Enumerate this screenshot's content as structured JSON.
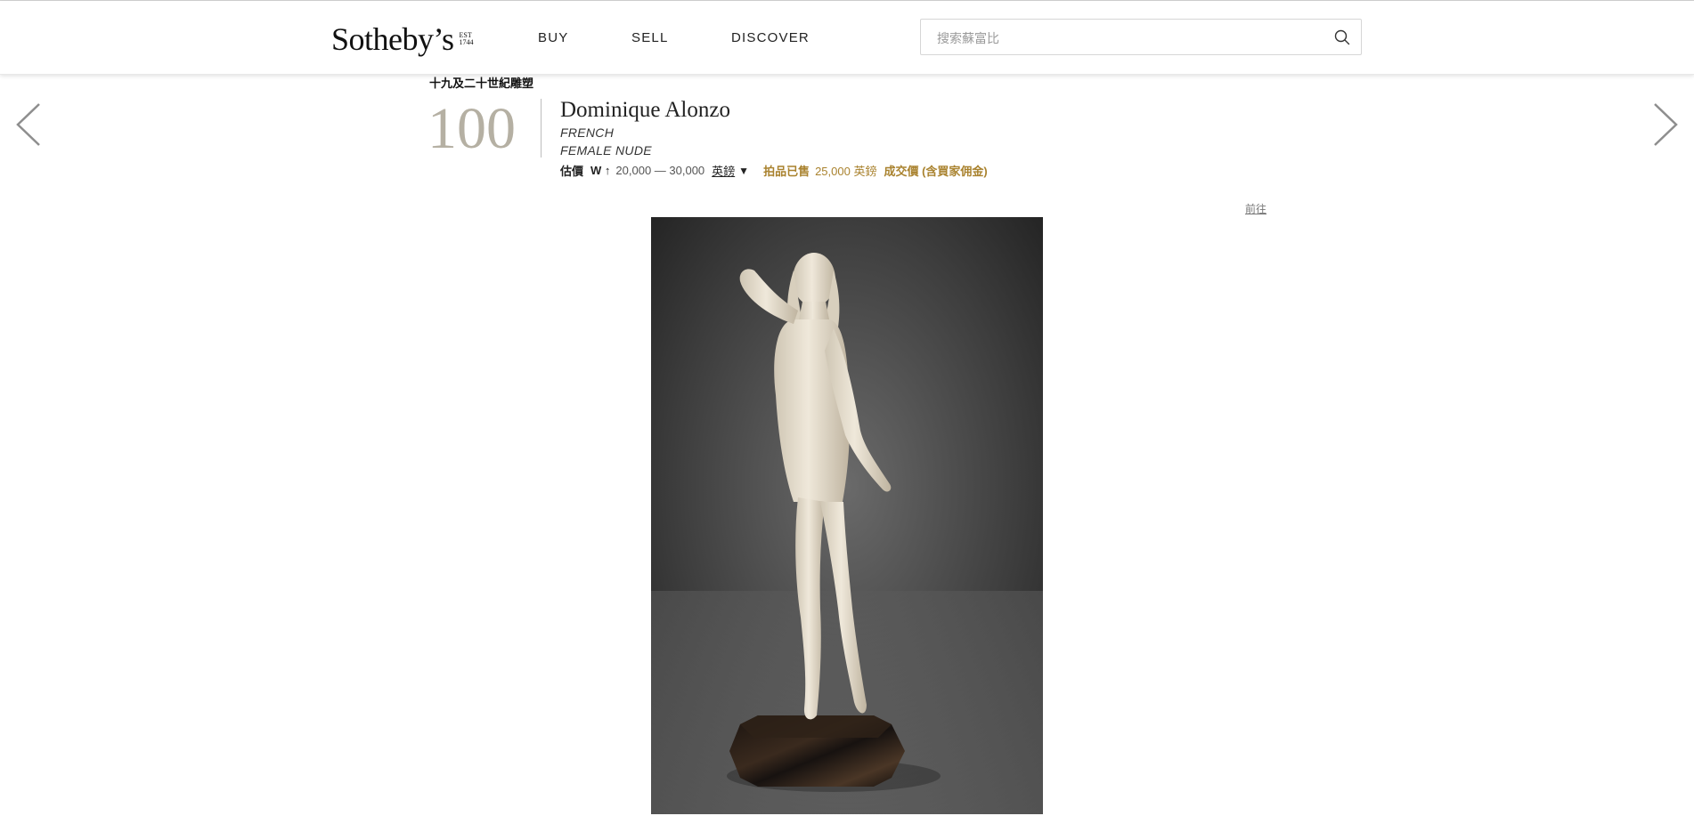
{
  "header": {
    "logo": {
      "wordmark": "Sotheby’s",
      "est_lines": [
        "EST",
        "1744"
      ]
    },
    "nav": [
      {
        "label": "BUY"
      },
      {
        "label": "SELL"
      },
      {
        "label": "DISCOVER"
      }
    ],
    "search": {
      "placeholder": "搜索蘇富比",
      "value": ""
    }
  },
  "lot": {
    "collection": "十九及二十世紀雕塑",
    "number": "100",
    "artist": "Dominique Alonzo",
    "nationality": "FRENCH",
    "title": "FEMALE NUDE",
    "estimate_label": "估價",
    "estimate_marker": "W ↑",
    "estimate_range": "20,000 — 30,000",
    "currency": "英鎊",
    "sold_label": "拍品已售",
    "sold_value": "25,000 英鎊",
    "sold_note": "成交價 (含買家佣金)"
  },
  "goto_link": "前往",
  "icons": {
    "prev": "chevron-left-icon",
    "next": "chevron-right-icon",
    "search": "search-icon",
    "currency_toggle": "caret-down-icon"
  },
  "colors": {
    "lot_number": "#b5b0a3",
    "sold_accent": "#a9822e",
    "header_border": "#e8e8e8"
  }
}
